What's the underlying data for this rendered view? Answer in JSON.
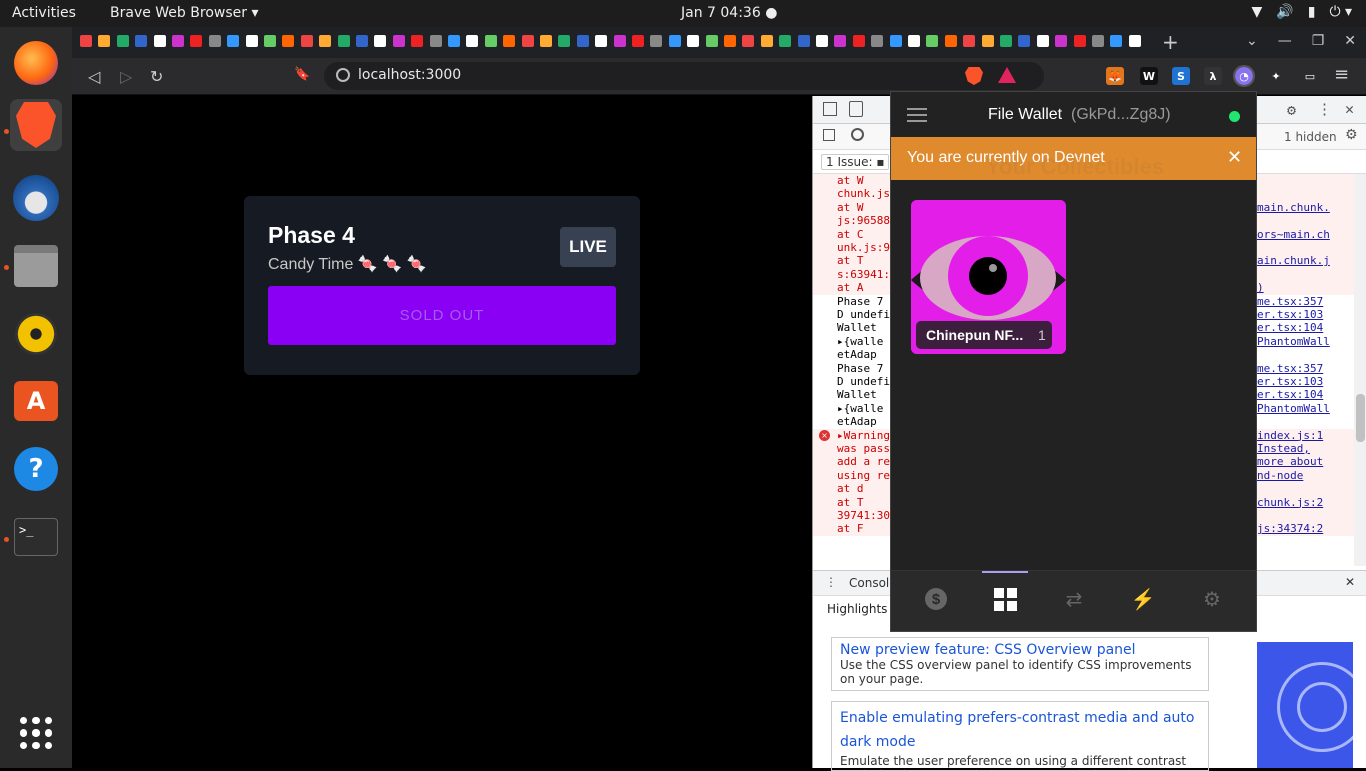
{
  "topbar": {
    "activities": "Activities",
    "app_name": "Brave Web Browser ▾",
    "clock": "Jan 7  04:36",
    "record_dot": "●",
    "wifi": "▼",
    "volume": "🔊",
    "battery": "▮",
    "power_menu": "⏻ ▾"
  },
  "dock": {
    "items": [
      {
        "name": "firefox",
        "color": "#ff6611"
      },
      {
        "name": "brave",
        "color": "#fb542b"
      },
      {
        "name": "thunderbird",
        "color": "#2f6bb8"
      },
      {
        "name": "files",
        "color": "#9b9b9b"
      },
      {
        "name": "rhythmbox",
        "color": "#f2c200"
      },
      {
        "name": "software",
        "color": "#e95420"
      },
      {
        "name": "help",
        "color": "#1e88e5"
      },
      {
        "name": "terminal",
        "color": "#2d2d2d"
      }
    ],
    "help_glyph": "?",
    "terminal_glyph": ">_"
  },
  "tabstrip": {
    "new_tab": "+",
    "win_minimize": "—",
    "win_restore": "❐",
    "win_close": "✕",
    "tab_menu": "⌄"
  },
  "addressbar": {
    "back": "◁",
    "forward": "▷",
    "reload": "↻",
    "bookmark": "🔖",
    "url": "localhost:3000",
    "menu": "≡",
    "extensions": [
      {
        "name": "metamask",
        "color": "#e2761b",
        "glyph": "🦊"
      },
      {
        "name": "wallet-w",
        "color": "#111111",
        "glyph": "W"
      },
      {
        "name": "s-ext",
        "color": "#1e74d0",
        "glyph": "S"
      },
      {
        "name": "lambda-ext",
        "color": "#333333",
        "glyph": "λ"
      },
      {
        "name": "phantom",
        "color": "#8b73f0",
        "glyph": "◔"
      },
      {
        "name": "puzzle",
        "color": "#2b2b2e",
        "glyph": "✦"
      },
      {
        "name": "wallet-icon",
        "color": "#2b2b2e",
        "glyph": "▭"
      }
    ]
  },
  "mint_card": {
    "title": "Phase 4",
    "subtitle": "Candy Time 🍬 🍬 🍬",
    "badge": "LIVE",
    "button": "SOLD OUT"
  },
  "devtools": {
    "issues": "1 Issue: ▪",
    "hidden": "1 hidden",
    "log_lines": [
      {
        "t": "    at W",
        "red": true,
        "src": ""
      },
      {
        "t": "chunk.js",
        "red": true,
        "src": ""
      },
      {
        "t": "    at W",
        "red": true,
        "src": "main.chunk."
      },
      {
        "t": "js:96588",
        "red": true,
        "src": ""
      },
      {
        "t": "    at C",
        "red": true,
        "src": "ors~main.ch"
      },
      {
        "t": "unk.js:9",
        "red": true,
        "src": ""
      },
      {
        "t": "    at T",
        "red": true,
        "src": "ain.chunk.j"
      },
      {
        "t": "s:63941:",
        "red": true,
        "src": ""
      },
      {
        "t": "    at A",
        "red": true,
        "src": ")"
      },
      {
        "t": "Phase 7",
        "red": false,
        "src": "me.tsx:357"
      },
      {
        "t": "D undefi",
        "red": false,
        "src": "er.tsx:103"
      },
      {
        "t": "Wallet",
        "red": false,
        "src": "er.tsx:104"
      },
      {
        "t": " ▸{walle",
        "red": false,
        "src": "PhantomWall"
      },
      {
        "t": "  etAdap",
        "red": false,
        "src": ""
      },
      {
        "t": "Phase 7",
        "red": false,
        "src": "me.tsx:357"
      },
      {
        "t": "D undefi",
        "red": false,
        "src": "er.tsx:103"
      },
      {
        "t": "Wallet",
        "red": false,
        "src": "er.tsx:104"
      },
      {
        "t": " ▸{walle",
        "red": false,
        "src": "PhantomWall"
      },
      {
        "t": "  etAdap",
        "red": false,
        "src": ""
      },
      {
        "t": "▸Warning",
        "red": true,
        "src": "index.js:1"
      },
      {
        "t": "was pass",
        "red": true,
        "src": " Instead,"
      },
      {
        "t": "add a re",
        "red": true,
        "src": "more about"
      },
      {
        "t": "using re",
        "red": true,
        "src": "nd-node"
      },
      {
        "t": "    at d",
        "red": true,
        "src": ""
      },
      {
        "t": "    at T",
        "red": true,
        "src": "chunk.js:2"
      },
      {
        "t": "39741:30",
        "red": true,
        "src": ""
      },
      {
        "t": "    at F",
        "red": true,
        "src": "js:34374:2"
      }
    ],
    "drawer_tab": "Console",
    "drawer_close": "✕",
    "highlights": "Highlights f",
    "whatsnew": [
      {
        "title": "New preview feature: CSS Overview panel",
        "desc": "Use the CSS overview panel to identify CSS improvements on your page."
      },
      {
        "title": "Enable emulating prefers-contrast media and auto dark mode",
        "desc": "Emulate the user preference on using a different contrast mode for the page and Chrome's auto dark mode."
      }
    ]
  },
  "wallet": {
    "name": "File Wallet",
    "address": "(GkPd...Zg8J)",
    "banner": "You are currently on Devnet",
    "banner_close": "✕",
    "section_title": "Your Collectibles",
    "nft_label": "Chinepun NF...",
    "nft_count": "1",
    "tabs": [
      {
        "name": "tokens-tab",
        "glyph": "$"
      },
      {
        "name": "collectibles-tab",
        "glyph": "▦"
      },
      {
        "name": "swap-tab",
        "glyph": "⇄"
      },
      {
        "name": "activity-tab",
        "glyph": "⚡"
      },
      {
        "name": "settings-tab",
        "glyph": "⚙"
      }
    ]
  }
}
